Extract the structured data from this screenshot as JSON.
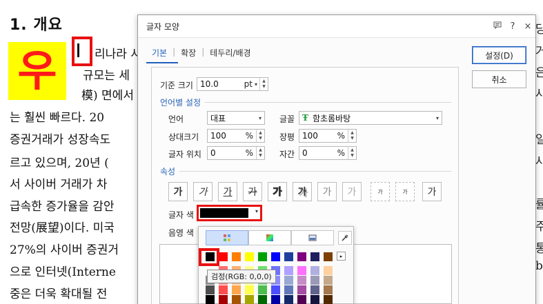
{
  "document": {
    "heading": "1. 개요",
    "dropcap": "우",
    "lines": [
      "리나라  사",
      "규모는  세",
      "模) 면에서",
      "는 훨씬  빠르다. 20",
      "증권거래가 성장속도",
      "르고 있으며, 20년 (",
      "서 사이버 거래가 차",
      "급속한 증가율을 감안",
      "전망(展望)이다.  미국",
      "27%의 사이버 증권거",
      "으로 인터넷(Interne",
      "중은 더욱 확대될 전"
    ],
    "right_fragments": [
      "당",
      "거",
      "은",
      "사",
      "일",
      "사",
      "률",
      "주",
      "통",
      "b"
    ]
  },
  "dialog": {
    "title": "글자 모양",
    "help_label": "?",
    "close_label": "×",
    "tabs": [
      "기본",
      "확장",
      "테두리/배경"
    ],
    "tab_separator": "|",
    "ok_button": "설정(D)",
    "cancel_button": "취소",
    "base_size_label": "기준 크기",
    "base_size_value": "10.0",
    "base_size_unit": "pt",
    "lang_section": "언어별 설정",
    "language_label": "언어",
    "language_value": "대표",
    "font_label": "글꼴",
    "font_value": "함초롬바탕",
    "font_icon": "TT-font-icon",
    "rel_size_label": "상대크기",
    "rel_size_value": "100",
    "width_label": "장평",
    "width_value": "100",
    "position_label": "글자 위치",
    "position_value": "0",
    "spacing_label": "자간",
    "spacing_value": "0",
    "percent": "%",
    "attr_section": "속성",
    "attr_buttons": [
      "가",
      "가",
      "가",
      "가",
      "가",
      "가",
      "가",
      "가",
      "가",
      "가",
      "가"
    ],
    "text_color_label": "글자 색",
    "shade_color_label": "음영 색",
    "text_color_hex": "#000000",
    "accent": "#1f5fbf"
  },
  "palette": {
    "tooltip": "검정(RGB: 0,0,0)",
    "more_label": "▸",
    "colors_row1": [
      "#000000",
      "#ff0000",
      "#ff7f00",
      "#ffff00",
      "#00a000",
      "#0000ff",
      "#1f3f9f",
      "#7f007f",
      "#1f1f5f",
      "#7f3f00"
    ],
    "label_row": [
      "#ffffff",
      "#ff7070",
      "#ffb070",
      "#ffff90",
      "#70e070",
      "#7070ff",
      "#b0a0ff",
      "#ff70ff",
      "#b0b0e0",
      "#ffd0a0"
    ]
  }
}
